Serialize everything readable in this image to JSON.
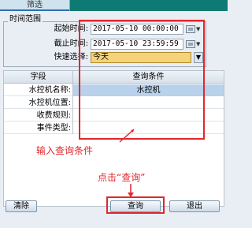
{
  "title_tab": "筛选",
  "time_range": {
    "legend": "时间范围",
    "start_label": "起始时间:",
    "start_value": "2017-05-10 00:00:00",
    "end_label": "截止时间:",
    "end_value": "2017-05-10 23:59:59",
    "quick_label": "快速选择:",
    "quick_value": "今天"
  },
  "table": {
    "headers": [
      "字段",
      "查询条件"
    ],
    "rows": [
      {
        "label": "水控机名称:",
        "value": "水控机"
      },
      {
        "label": "水控机位置:",
        "value": ""
      },
      {
        "label": "收费规则:",
        "value": ""
      },
      {
        "label": "事件类型:",
        "value": ""
      }
    ]
  },
  "buttons": {
    "clear": "清除",
    "query": "查询",
    "exit": "退出"
  },
  "annotations": {
    "input_hint": "输入查询条件",
    "click_hint": "点击“查询”"
  },
  "colors": {
    "title_bar": "#0f7a73",
    "highlight": "#e0282e",
    "selected_field": "#f5d37a"
  }
}
